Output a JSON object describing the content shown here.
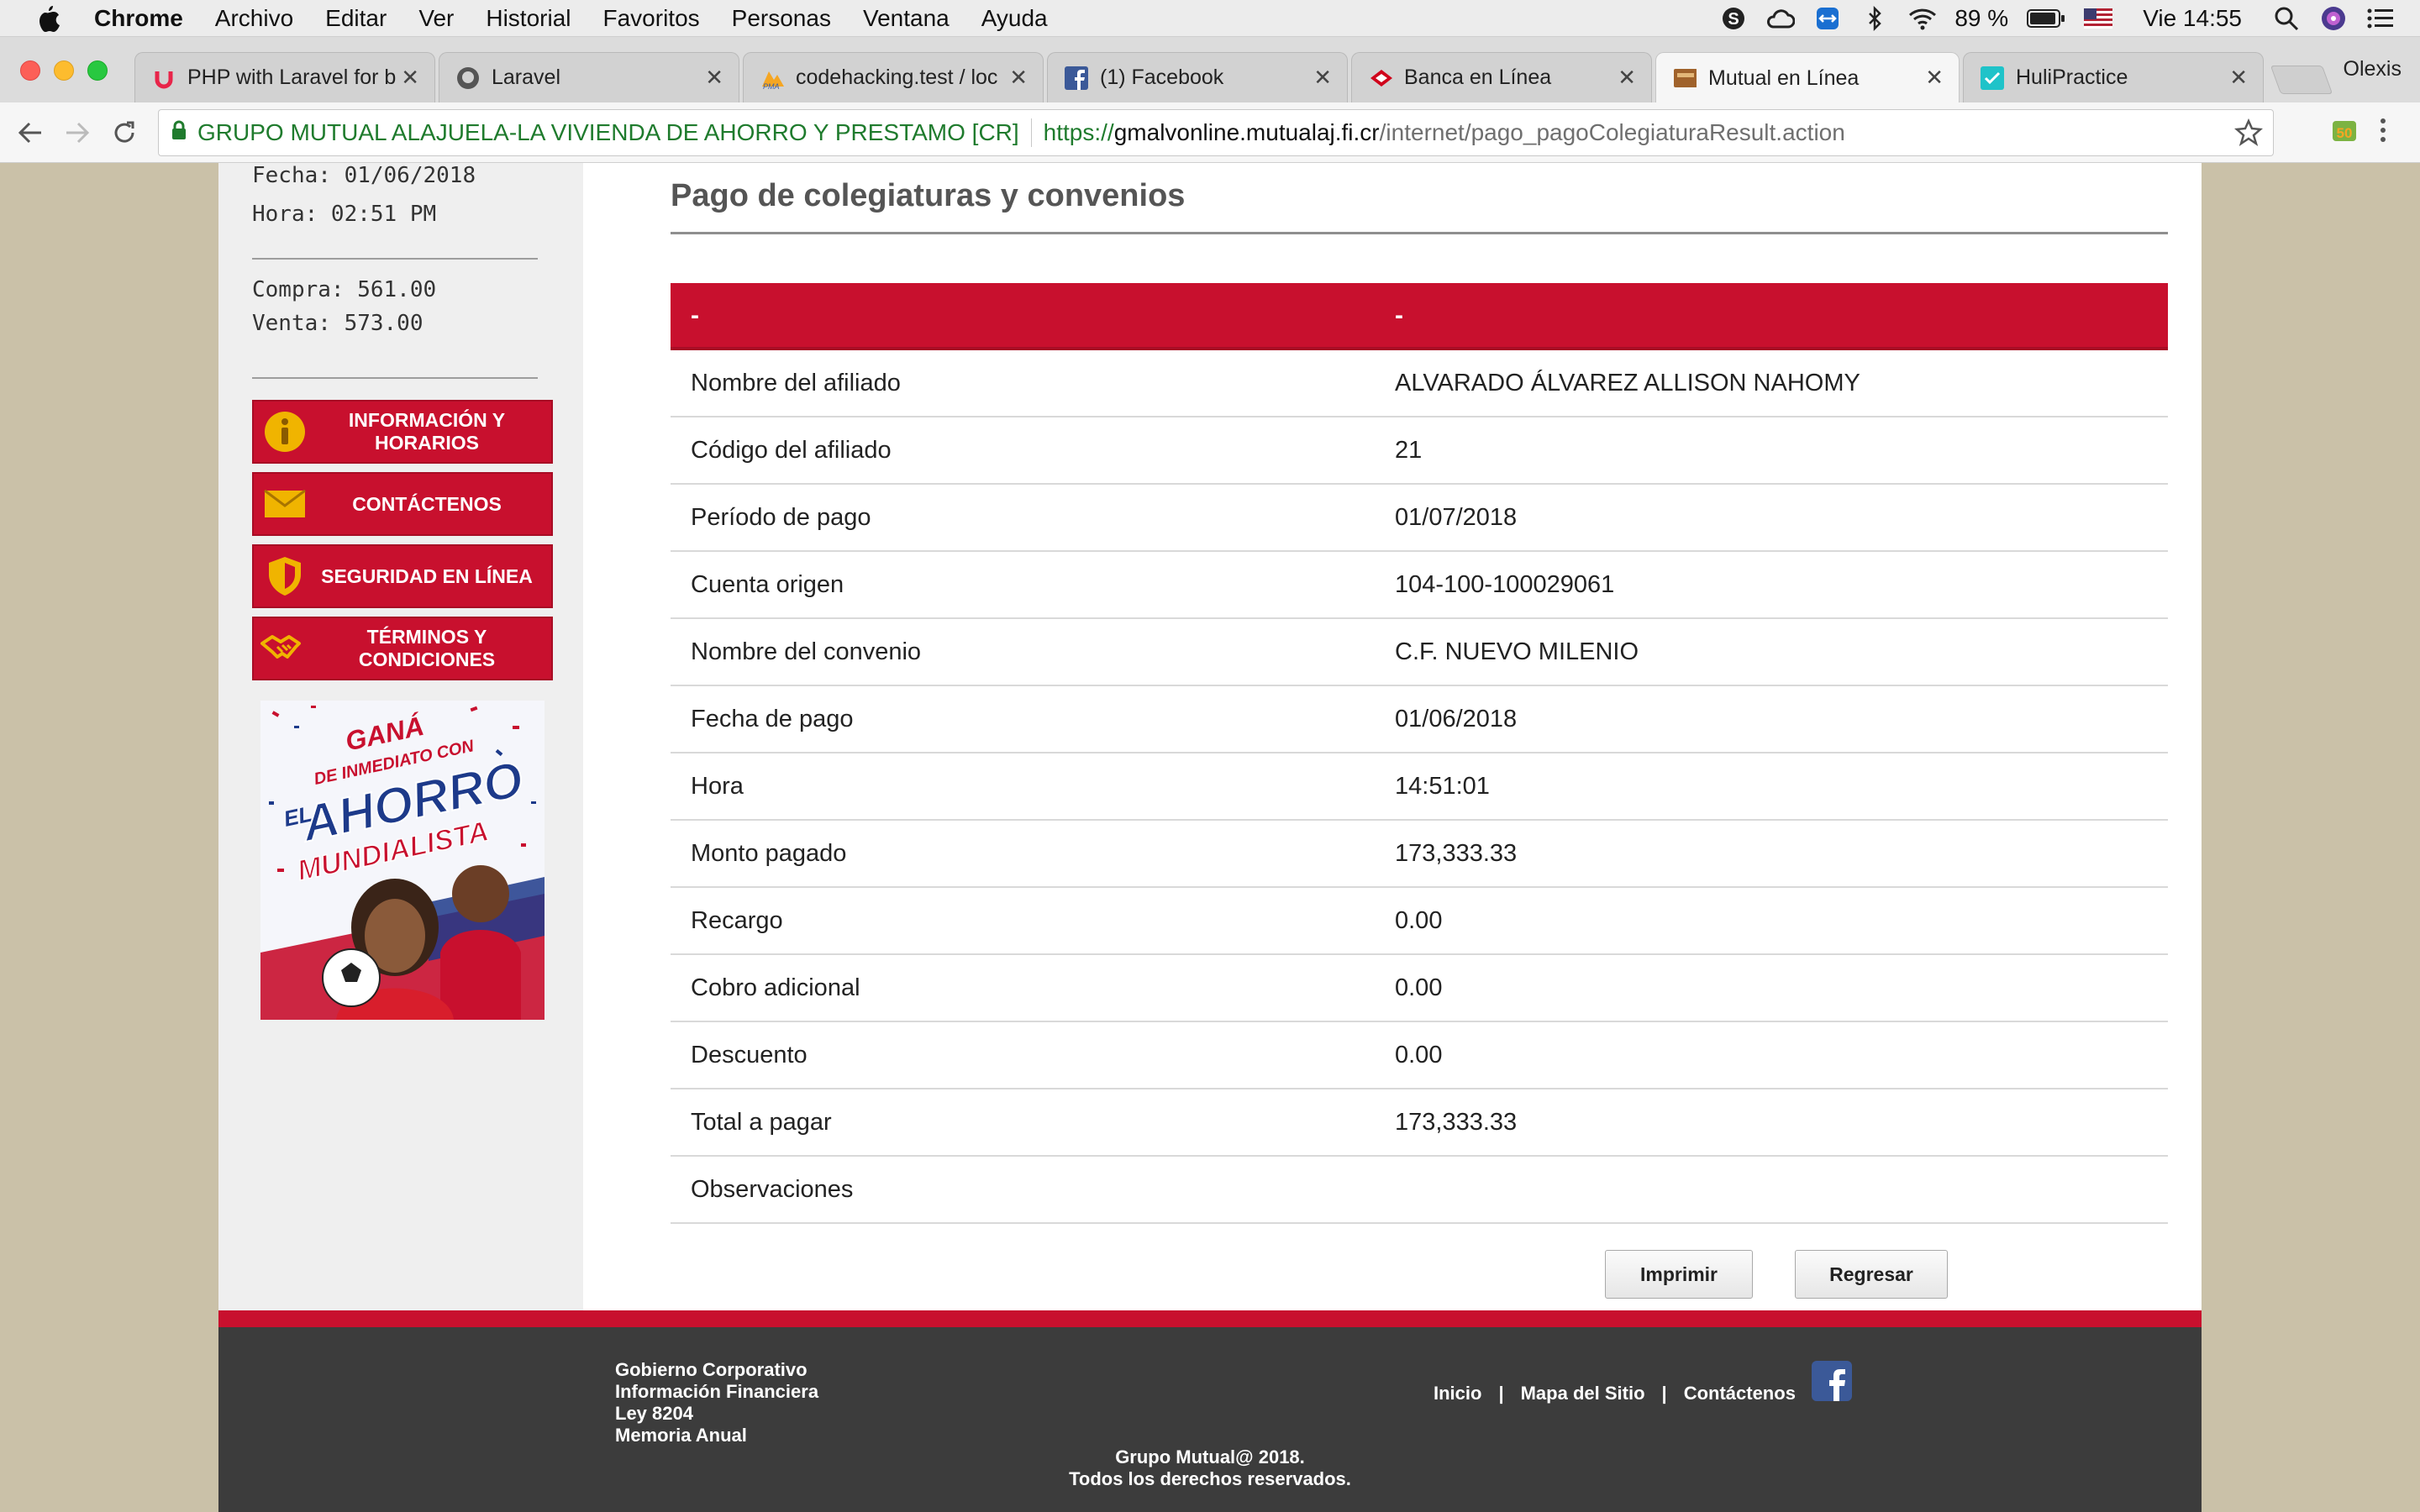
{
  "menubar": {
    "app": "Chrome",
    "items": [
      "Archivo",
      "Editar",
      "Ver",
      "Historial",
      "Favoritos",
      "Personas",
      "Ventana",
      "Ayuda"
    ],
    "battery": "89 %",
    "clock": "Vie 14:55"
  },
  "tabs": [
    {
      "title": "PHP with Laravel for b",
      "icon": "udemy-icon"
    },
    {
      "title": "Laravel",
      "icon": "github-icon"
    },
    {
      "title": "codehacking.test / loc",
      "icon": "phpmyadmin-icon"
    },
    {
      "title": "(1) Facebook",
      "icon": "facebook-icon"
    },
    {
      "title": "Banca en Línea",
      "icon": "bank-icon"
    },
    {
      "title": "Mutual en Línea",
      "icon": "mutual-icon",
      "active": true
    },
    {
      "title": "HuliPractice",
      "icon": "huli-icon"
    }
  ],
  "profile": "Olexis",
  "address": {
    "ev_name": "GRUPO MUTUAL ALAJUELA-LA VIVIENDA DE AHORRO Y PRESTAMO [CR]",
    "scheme": "https://",
    "host": "gmalvonline.mutualaj.fi.cr",
    "path": "/internet/pago_pagoColegiaturaResult.action"
  },
  "sidebar": {
    "fecha": "Fecha: 01/06/2018",
    "hora": "Hora: 02:51 PM",
    "compra": "Compra: 561.00",
    "venta": "Venta: 573.00",
    "buttons": [
      {
        "label": "INFORMACIÓN Y HORARIOS",
        "icon": "info-icon"
      },
      {
        "label": "CONTÁCTENOS",
        "icon": "envelope-icon"
      },
      {
        "label": "SEGURIDAD EN LÍNEA",
        "icon": "shield-icon"
      },
      {
        "label": "TÉRMINOS Y CONDICIONES",
        "icon": "handshake-icon"
      }
    ],
    "promo": {
      "line1": "GANÁ",
      "line2": "DE INMEDIATO CON",
      "line3": "EL",
      "line4": "AHORRO",
      "line5": "MUNDIALISTA"
    }
  },
  "main": {
    "title": "Pago de colegiaturas y convenios",
    "header": [
      "-",
      "-"
    ],
    "rows": [
      {
        "label": "Nombre del afiliado",
        "value": "ALVARADO ÁLVAREZ ALLISON NAHOMY"
      },
      {
        "label": "Código del afiliado",
        "value": "21"
      },
      {
        "label": "Período de pago",
        "value": "01/07/2018"
      },
      {
        "label": "Cuenta origen",
        "value": "104-100-100029061"
      },
      {
        "label": "Nombre del convenio",
        "value": "C.F. NUEVO MILENIO"
      },
      {
        "label": "Fecha de pago",
        "value": "01/06/2018"
      },
      {
        "label": "Hora",
        "value": "14:51:01"
      },
      {
        "label": "Monto pagado",
        "value": "173,333.33"
      },
      {
        "label": "Recargo",
        "value": "0.00"
      },
      {
        "label": "Cobro adicional",
        "value": "0.00"
      },
      {
        "label": "Descuento",
        "value": "0.00"
      },
      {
        "label": "Total a pagar",
        "value": "173,333.33"
      },
      {
        "label": "Observaciones",
        "value": ""
      }
    ],
    "print_label": "Imprimir",
    "back_label": "Regresar"
  },
  "footer": {
    "links_left": [
      "Gobierno Corporativo",
      "Información Financiera",
      "Ley 8204",
      "Memoria Anual"
    ],
    "links_right": [
      "Inicio",
      "Mapa del Sitio",
      "Contáctenos"
    ],
    "separator": "|",
    "copyright1": "Grupo Mutual@ 2018.",
    "copyright2": "Todos los derechos reservados."
  },
  "colors": {
    "brand_red": "#c8102e",
    "page_bg": "#cac1a8",
    "footer_bg": "#3c3c3c",
    "ev_green": "#1f7b2d"
  }
}
